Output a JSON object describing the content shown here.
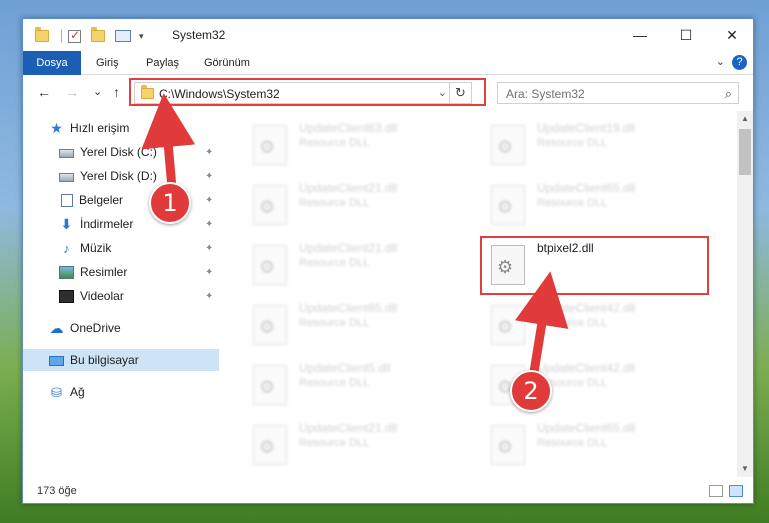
{
  "window": {
    "title": "System32",
    "minimize_glyph": "—",
    "maximize_glyph": "☐",
    "close_glyph": "✕"
  },
  "ribbon": {
    "tabs": [
      "Dosya",
      "Giriş",
      "Paylaş",
      "Görünüm"
    ],
    "help": "?",
    "collapse": "⌄"
  },
  "nav": {
    "back": "←",
    "forward": "→",
    "recent": "⌄",
    "up": "↑",
    "address": "C:\\Windows\\System32",
    "dropdown": "⌄",
    "refresh": "↻"
  },
  "search": {
    "placeholder": "Ara: System32",
    "icon": "search-icon"
  },
  "sidebar": {
    "items": [
      {
        "label": "Hızlı erişim",
        "icon": "star-icon"
      },
      {
        "label": "Yerel Disk (C:)",
        "icon": "disk-icon",
        "pinned": true
      },
      {
        "label": "Yerel Disk (D:)",
        "icon": "disk-icon",
        "pinned": true
      },
      {
        "label": "Belgeler",
        "icon": "documents-icon",
        "pinned": true
      },
      {
        "label": "İndirmeler",
        "icon": "download-icon",
        "pinned": true
      },
      {
        "label": "Müzik",
        "icon": "music-icon",
        "pinned": true
      },
      {
        "label": "Resimler",
        "icon": "pictures-icon",
        "pinned": true
      },
      {
        "label": "Videolar",
        "icon": "videos-icon",
        "pinned": true
      },
      {
        "label": "OneDrive",
        "icon": "cloud-icon"
      },
      {
        "label": "Bu bilgisayar",
        "icon": "computer-icon",
        "selected": true
      },
      {
        "label": "Ağ",
        "icon": "network-icon"
      }
    ],
    "pin_glyph": "📌"
  },
  "files": {
    "left": [
      {
        "name": "UpdateClient63.dll",
        "desc": "Resource DLL"
      },
      {
        "name": "UpdateClient21.dll",
        "desc": "Resource DLL"
      },
      {
        "name": "UpdateClient21.dll",
        "desc": "Resource DLL"
      },
      {
        "name": "UpdateClient65.dll",
        "desc": "Resource DLL"
      },
      {
        "name": "UpdateClient5.dll",
        "desc": "Resource DLL"
      },
      {
        "name": "UpdateClient21.dll",
        "desc": "Resource DLL"
      }
    ],
    "right": [
      {
        "name": "UpdateClient19.dll",
        "desc": "Resource DLL"
      },
      {
        "name": "UpdateClient65.dll",
        "desc": "Resource DLL"
      },
      {
        "name": "btpixel2.dll",
        "desc": "",
        "highlighted": true
      },
      {
        "name": "UpdateClient42.dll",
        "desc": "Resource DLL"
      },
      {
        "name": "UpdateClient42.dll",
        "desc": "Resource DLL"
      },
      {
        "name": "UpdateClient65.dll",
        "desc": "Resource DLL"
      }
    ]
  },
  "status": {
    "count": "173 öğe"
  },
  "annotations": {
    "badge1": "1",
    "badge2": "2",
    "color": "#e03a3a"
  }
}
